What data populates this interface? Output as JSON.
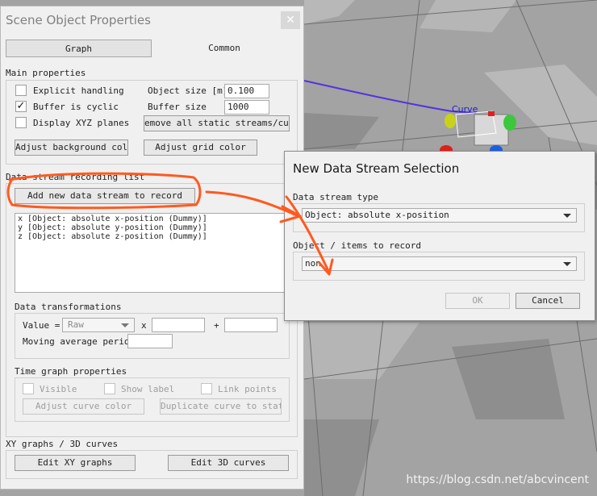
{
  "main_window": {
    "title": "Scene Object Properties",
    "close_glyph": "✕",
    "tabs": [
      {
        "label": "Graph",
        "active": true
      },
      {
        "label": "Common",
        "active": false
      }
    ],
    "main_properties": {
      "heading": "Main properties",
      "explicit_handling": {
        "label": "Explicit handling",
        "checked": false
      },
      "buffer_cyclic": {
        "label": "Buffer is cyclic",
        "checked": true,
        "mark": "✓"
      },
      "display_xyz": {
        "label": "Display XYZ planes",
        "checked": false
      },
      "object_size_label": "Object size [m]",
      "object_size_value": "0.100",
      "buffer_size_label": "Buffer size",
      "buffer_size_value": "1000",
      "remove_streams_button": "emove all static streams/curve",
      "adjust_bg_button": "Adjust background color",
      "adjust_grid_button": "Adjust grid color"
    },
    "data_stream": {
      "heading": "Data stream recording list",
      "add_button": "Add new data stream to record",
      "items": [
        "x [Object: absolute x-position (Dummy)]",
        "y [Object: absolute y-position (Dummy)]",
        "z [Object: absolute z-position (Dummy)]"
      ]
    },
    "transformations": {
      "heading": "Data transformations",
      "value_label": "Value =",
      "value_select": "Raw",
      "times_label": "x",
      "plus_label": "+",
      "moving_avg_label": "Moving average period"
    },
    "time_graph": {
      "heading": "Time graph properties",
      "visible_label": "Visible",
      "show_label_label": "Show label",
      "link_points_label": "Link points",
      "adjust_curve_button": "Adjust curve color",
      "duplicate_button": "Duplicate curve to static"
    },
    "xy_graphs": {
      "heading": "XY graphs / 3D curves",
      "edit_xy_button": "Edit XY graphs",
      "edit_3d_button": "Edit 3D curves"
    }
  },
  "dialog": {
    "title": "New Data Stream Selection",
    "stream_type_label": "Data stream type",
    "stream_type_value": "Object: absolute x-position",
    "objects_label": "Object / items to record",
    "objects_value": "non",
    "ok_button": "OK",
    "cancel_button": "Cancel"
  },
  "scene": {
    "curve_label": "Curve"
  },
  "watermark": "https://blog.csdn.net/abcvincent",
  "colors": {
    "annotation": "#ff5a1f",
    "curve": "#5533dd"
  }
}
